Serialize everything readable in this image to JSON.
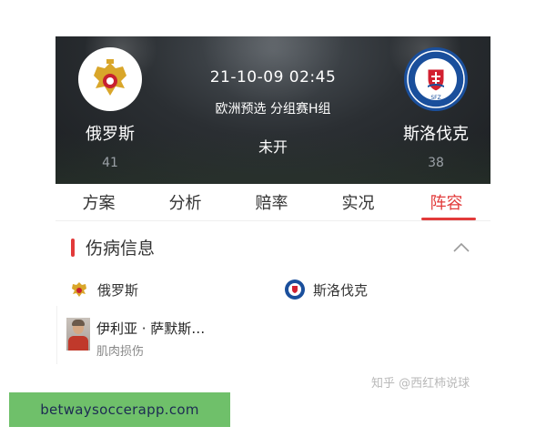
{
  "match": {
    "home": {
      "name": "俄罗斯",
      "rank": "41",
      "crest_icon": "russia-eagle-crest-icon"
    },
    "away": {
      "name": "斯洛伐克",
      "rank": "38",
      "crest_icon": "slovakia-sfz-crest-icon",
      "crest_text": "SFZ"
    },
    "datetime": "21-10-09 02:45",
    "competition": "欧洲预选 分组赛H组",
    "status": "未开"
  },
  "tabs": [
    {
      "label": "方案"
    },
    {
      "label": "分析"
    },
    {
      "label": "赔率"
    },
    {
      "label": "实况"
    },
    {
      "label": "阵容",
      "active": true
    }
  ],
  "injury": {
    "title": "伤病信息",
    "collapse_icon": "chevron-up-icon",
    "home_team": "俄罗斯",
    "away_team": "斯洛伐克",
    "players": [
      {
        "name": "伊利亚 · 萨默斯…",
        "injury": "肌肉损伤"
      }
    ]
  },
  "watermark": "知乎 @西红柿说球",
  "banner": {
    "text": "betwaysoccerapp.com"
  },
  "colors": {
    "accent": "#e23a3a",
    "header_bg": "#2b2f33",
    "banner_bg": "#6fc06a",
    "away_crest": "#1a4f9c"
  }
}
